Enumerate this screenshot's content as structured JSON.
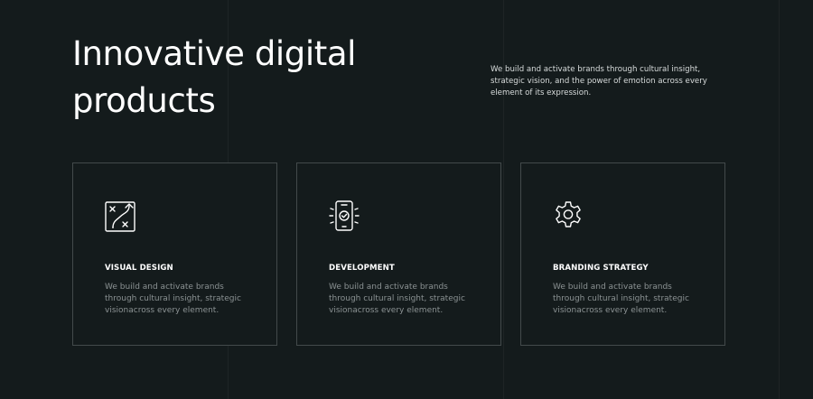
{
  "hero": {
    "title": "Innovative digital products",
    "description": "We build and activate brands through cultural insight, strategic vision, and the power of emotion across every element of its expression."
  },
  "services": [
    {
      "icon": "strategy-map-icon",
      "title": "VISUAL DESIGN",
      "text": "We build and activate brands through cultural insight, strategic visionacross every element."
    },
    {
      "icon": "mobile-check-icon",
      "title": "DEVELOPMENT",
      "text": "We build and activate brands through cultural insight, strategic visionacross every element."
    },
    {
      "icon": "gear-icon",
      "title": "BRANDING STRATEGY",
      "text": "We build and activate brands through cultural insight, strategic visionacross every element."
    }
  ],
  "colors": {
    "background": "#141b1c",
    "card_border": "#434a4b",
    "heading": "#ffffff",
    "body_text": "#8b9293",
    "description_text": "#d8dcdc"
  }
}
